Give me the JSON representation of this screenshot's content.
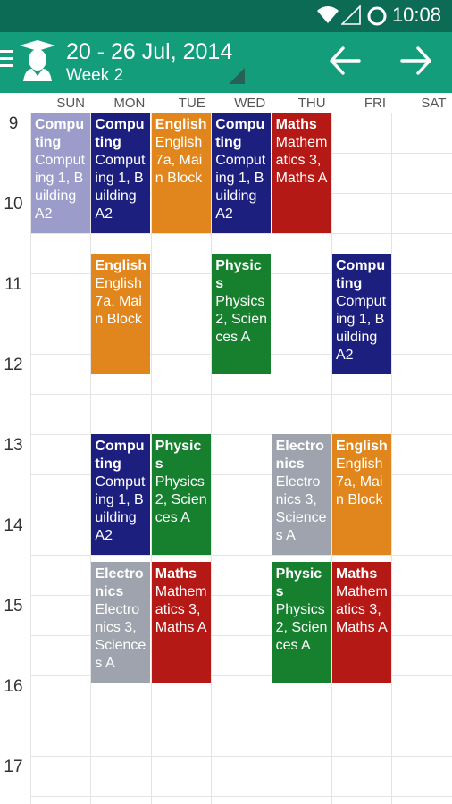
{
  "status": {
    "time": "10:08"
  },
  "header": {
    "title": "20 - 26 Jul, 2014",
    "subtitle": "Week 2"
  },
  "days": [
    "SUN",
    "MON",
    "TUE",
    "WED",
    "THU",
    "FRI",
    "SAT"
  ],
  "hours": [
    "9",
    "10",
    "11",
    "12",
    "13",
    "14",
    "15",
    "16",
    "17"
  ],
  "events": [
    {
      "title": "Computing",
      "detail": "Computing 1, Building A2",
      "color": "#9b9cc9",
      "day": "SUN",
      "start": "9:00",
      "end": "10:30"
    },
    {
      "title": "Computing",
      "detail": "Computing 1, Building A2",
      "color": "#1c1f7e",
      "day": "MON",
      "start": "9:00",
      "end": "10:30"
    },
    {
      "title": "English",
      "detail": "English 7a, Main Block",
      "color": "#e0861c",
      "day": "TUE",
      "start": "9:00",
      "end": "10:30"
    },
    {
      "title": "Computing",
      "detail": "Computing 1, Building A2",
      "color": "#1c1f7e",
      "day": "WED",
      "start": "9:00",
      "end": "10:30"
    },
    {
      "title": "Maths",
      "detail": "Mathematics 3, Maths A",
      "color": "#b51916",
      "day": "THU",
      "start": "9:00",
      "end": "10:30"
    },
    {
      "title": "English",
      "detail": "English 7a, Main Block",
      "color": "#e0861c",
      "day": "MON",
      "start": "10:45",
      "end": "12:15"
    },
    {
      "title": "Physics",
      "detail": "Physics 2, Sciences A",
      "color": "#17802f",
      "day": "WED",
      "start": "10:45",
      "end": "12:15"
    },
    {
      "title": "Computing",
      "detail": "Computing 1, Building A2",
      "color": "#1c1f7e",
      "day": "FRI",
      "start": "10:45",
      "end": "12:15"
    },
    {
      "title": "Computing",
      "detail": "Computing 1, Building A2",
      "color": "#1c1f7e",
      "day": "MON",
      "start": "13:00",
      "end": "14:30"
    },
    {
      "title": "Physics",
      "detail": "Physics 2, Sciences A",
      "color": "#17802f",
      "day": "TUE",
      "start": "13:00",
      "end": "14:30"
    },
    {
      "title": "Electronics",
      "detail": "Electronics 3, Sciences A",
      "color": "#9ea3ad",
      "day": "THU",
      "start": "13:00",
      "end": "14:30"
    },
    {
      "title": "English",
      "detail": "English 7a, Main Block",
      "color": "#e0861c",
      "day": "FRI",
      "start": "13:00",
      "end": "14:30"
    },
    {
      "title": "Electronics",
      "detail": "Electronics 3, Sciences A",
      "color": "#9ea3ad",
      "day": "MON",
      "start": "14:35",
      "end": "16:05"
    },
    {
      "title": "Maths",
      "detail": "Mathematics 3, Maths A",
      "color": "#b51916",
      "day": "TUE",
      "start": "14:35",
      "end": "16:05"
    },
    {
      "title": "Physics",
      "detail": "Physics 2, Sciences A",
      "color": "#17802f",
      "day": "THU",
      "start": "14:35",
      "end": "16:05"
    },
    {
      "title": "Maths",
      "detail": "Mathematics 3, Maths A",
      "color": "#b51916",
      "day": "FRI",
      "start": "14:35",
      "end": "16:05"
    }
  ]
}
